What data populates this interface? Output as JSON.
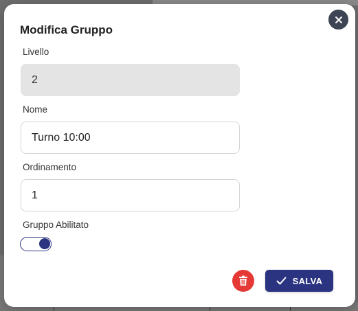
{
  "dialog": {
    "title": "Modifica Gruppo",
    "close_icon": "close-icon"
  },
  "fields": {
    "livello": {
      "label": "Livello",
      "value": "2",
      "disabled": true
    },
    "nome": {
      "label": "Nome",
      "value": "Turno 10:00"
    },
    "ordinamento": {
      "label": "Ordinamento",
      "value": "1"
    },
    "abilitato": {
      "label": "Gruppo Abilitato",
      "checked": true
    }
  },
  "actions": {
    "delete_icon": "trash-icon",
    "save_icon": "check-icon",
    "save_label": "SALVA"
  },
  "colors": {
    "primary": "#2b3481",
    "danger": "#e53935",
    "close_bg": "#3d4554",
    "disabled_input_bg": "#e4e4e4"
  }
}
